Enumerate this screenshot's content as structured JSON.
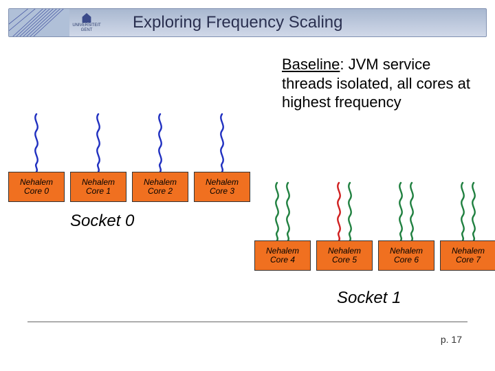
{
  "header": {
    "title": "Exploring Frequency Scaling",
    "logo_text1": "UNIVERSITEIT",
    "logo_text2": "GENT"
  },
  "baseline": {
    "label": "Baseline",
    "rest": ": JVM service threads isolated, all cores at highest frequency"
  },
  "socket0": {
    "label": "Socket 0",
    "cores": [
      {
        "line1": "Nehalem",
        "line2": "Core 0",
        "thread_color": "blue",
        "thread_count": 1
      },
      {
        "line1": "Nehalem",
        "line2": "Core 1",
        "thread_color": "blue",
        "thread_count": 1
      },
      {
        "line1": "Nehalem",
        "line2": "Core 2",
        "thread_color": "blue",
        "thread_count": 1
      },
      {
        "line1": "Nehalem",
        "line2": "Core 3",
        "thread_color": "blue",
        "thread_count": 1
      }
    ]
  },
  "socket1": {
    "label": "Socket 1",
    "cores": [
      {
        "line1": "Nehalem",
        "line2": "Core 4",
        "thread_color": "green",
        "thread_count": 2
      },
      {
        "line1": "Nehalem",
        "line2": "Core 5",
        "thread_color": "mixed",
        "thread_count": 2
      },
      {
        "line1": "Nehalem",
        "line2": "Core 6",
        "thread_color": "green",
        "thread_count": 2
      },
      {
        "line1": "Nehalem",
        "line2": "Core 7",
        "thread_color": "green",
        "thread_count": 2
      }
    ]
  },
  "colors": {
    "blue": "#2030c0",
    "green": "#208040",
    "red": "#d02020"
  },
  "footer": {
    "page": "p. 17"
  }
}
